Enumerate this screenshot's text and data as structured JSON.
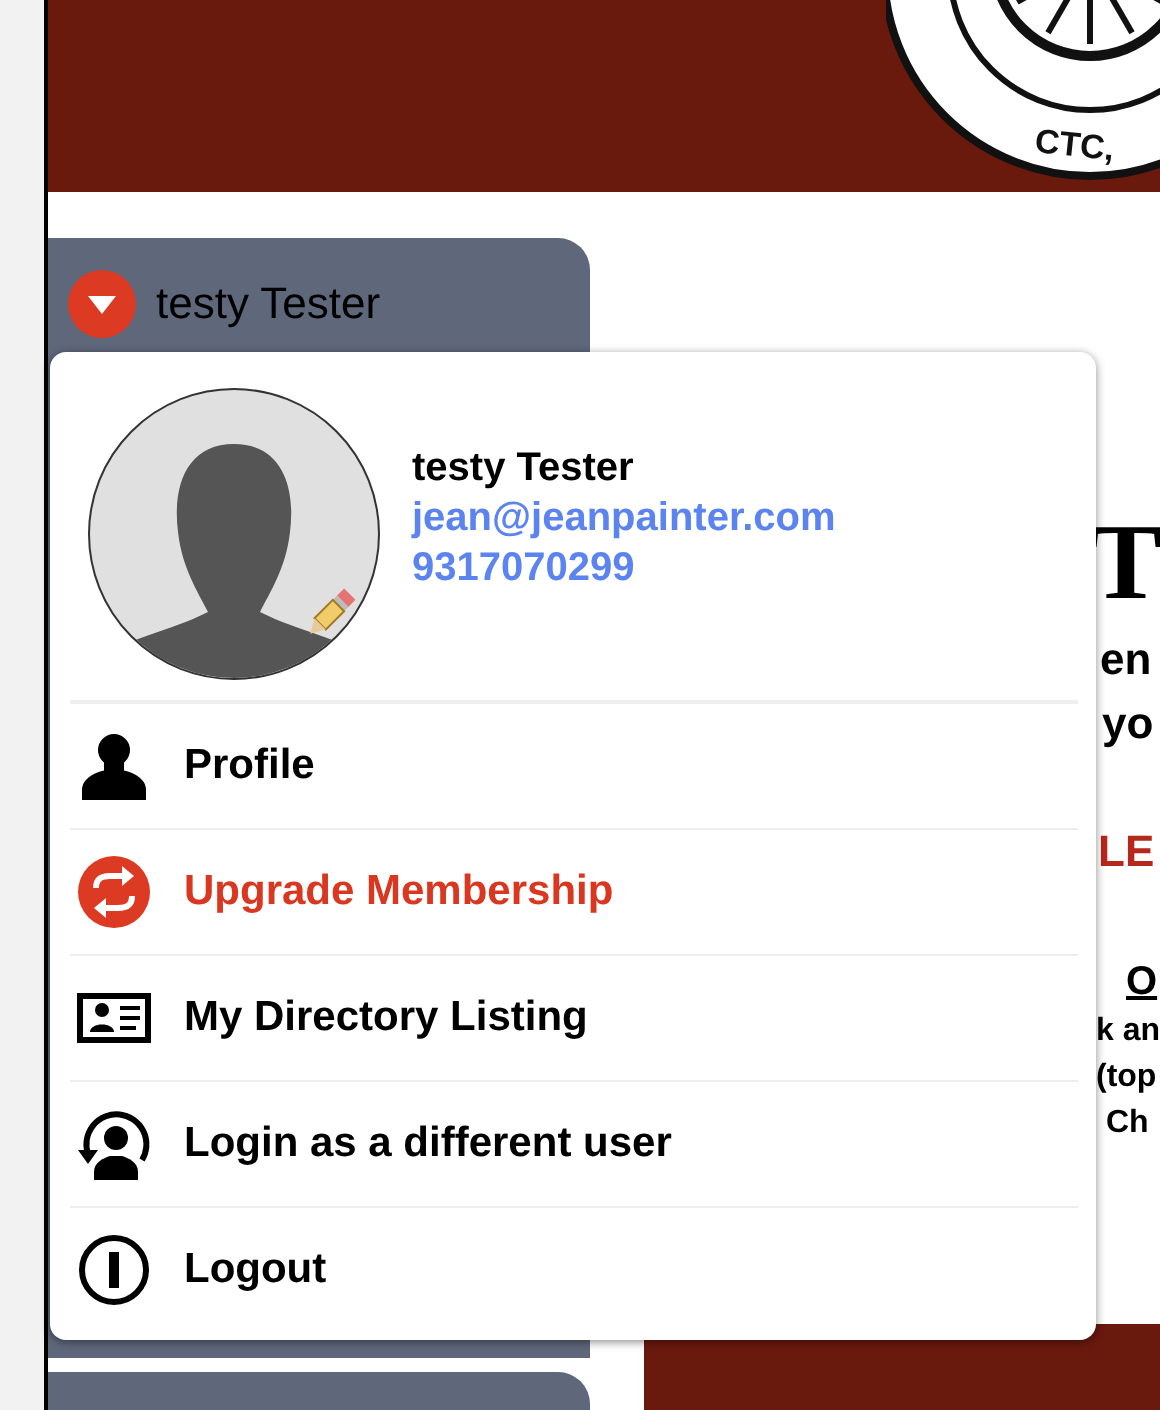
{
  "header": {
    "logo_text": "CTC,"
  },
  "account_menu": {
    "toggle": {
      "label": "testy Tester",
      "expanded": true
    },
    "user": {
      "name": "testy Tester",
      "email": "jean@jeanpainter.com",
      "phone": "9317070299"
    },
    "items": [
      {
        "label": "Profile",
        "kind": "profile",
        "accent": false
      },
      {
        "label": "Upgrade Membership",
        "kind": "upgrade",
        "accent": true
      },
      {
        "label": "My Directory Listing",
        "kind": "listing",
        "accent": false
      },
      {
        "label": "Login as a different user",
        "kind": "switch",
        "accent": false
      },
      {
        "label": "Logout",
        "kind": "logout",
        "accent": false
      }
    ]
  },
  "page_fragments": [
    {
      "text": "T",
      "kind": "title"
    },
    {
      "text": "en",
      "kind": "lead"
    },
    {
      "text": "yo",
      "kind": "lead2"
    },
    {
      "text": "LE",
      "kind": "alert"
    },
    {
      "text": "O",
      "kind": "heading"
    },
    {
      "text": "k an",
      "kind": "body"
    },
    {
      "text": "(top",
      "kind": "body"
    },
    {
      "text": "Ch",
      "kind": "body-indent"
    }
  ]
}
